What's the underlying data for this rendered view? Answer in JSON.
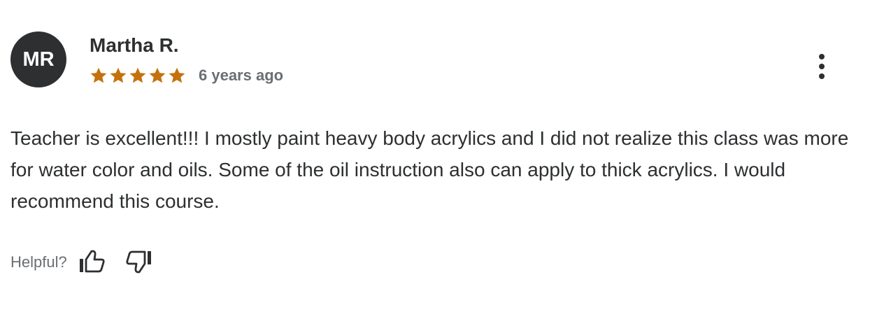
{
  "review": {
    "avatar_initials": "MR",
    "reviewer_name": "Martha R.",
    "rating": 5,
    "rating_max": 5,
    "star_color": "#c4710d",
    "age": "6 years ago",
    "body": "Teacher is excellent!!! I mostly paint heavy body acrylics and I did not realize this class was more for water color and oils. Some of the oil instruction also can apply to thick acrylics. I would recommend this course.",
    "more_options_icon": "more-vertical-icon"
  },
  "feedback": {
    "helpful_label": "Helpful?",
    "thumbs_up_icon": "thumbs-up-icon",
    "thumbs_down_icon": "thumbs-down-icon"
  }
}
